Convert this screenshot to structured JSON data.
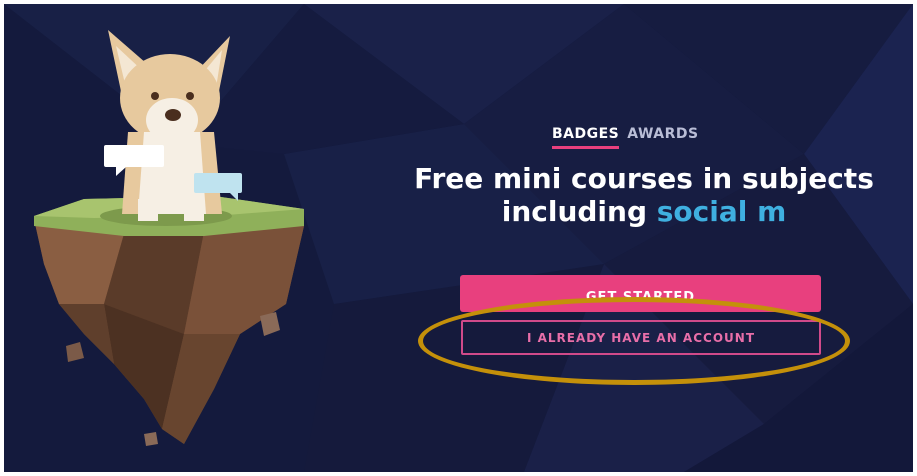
{
  "tabs": [
    {
      "label": "BADGES",
      "active": true
    },
    {
      "label": "AWARDS",
      "active": false
    }
  ],
  "headline": {
    "line1": "Free mini courses in subjects",
    "line2_prefix": "including ",
    "line2_accent": "social m"
  },
  "buttons": {
    "get_started": "GET STARTED",
    "have_account": "I ALREADY HAVE AN ACCOUNT"
  },
  "colors": {
    "background": "#141a3d",
    "accent_pink": "#e8407e",
    "accent_blue": "#3fb0e0",
    "annotation": "#c4900a"
  },
  "illustration": {
    "subject": "corgi-on-floating-island",
    "icons": [
      "speech-bubble-icon",
      "speech-bubble-icon"
    ]
  }
}
